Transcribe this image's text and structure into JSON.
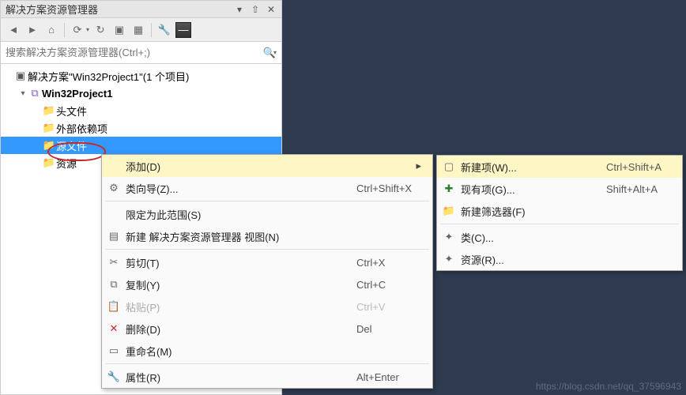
{
  "panel": {
    "title": "解决方案资源管理器",
    "search_placeholder": "搜索解决方案资源管理器(Ctrl+;)"
  },
  "tree": {
    "solution": "解决方案\"Win32Project1\"(1 个项目)",
    "project": "Win32Project1",
    "folders": {
      "headers": "头文件",
      "external": "外部依赖项",
      "source": "源文件",
      "resources": "资源"
    }
  },
  "ctx": {
    "add": "添加(D)",
    "wizard": "类向导(Z)...",
    "wizard_sc": "Ctrl+Shift+X",
    "scope": "限定为此范围(S)",
    "newview": "新建 解决方案资源管理器 视图(N)",
    "cut": "剪切(T)",
    "cut_sc": "Ctrl+X",
    "copy": "复制(Y)",
    "copy_sc": "Ctrl+C",
    "paste": "粘贴(P)",
    "paste_sc": "Ctrl+V",
    "delete": "删除(D)",
    "delete_sc": "Del",
    "rename": "重命名(M)",
    "props": "属性(R)",
    "props_sc": "Alt+Enter"
  },
  "sub": {
    "newitem": "新建项(W)...",
    "newitem_sc": "Ctrl+Shift+A",
    "existing": "现有项(G)...",
    "existing_sc": "Shift+Alt+A",
    "newfilter": "新建筛选器(F)",
    "class": "类(C)...",
    "resource": "资源(R)..."
  },
  "watermark": "https://blog.csdn.net/qq_37596943"
}
